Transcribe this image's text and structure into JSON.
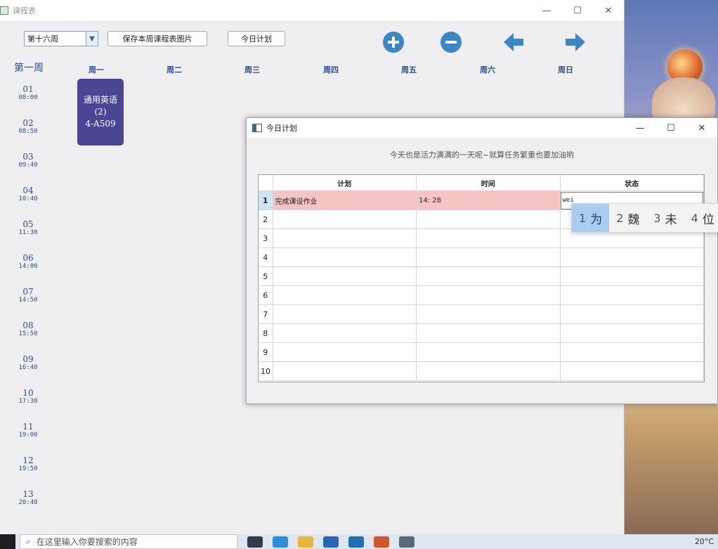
{
  "main_window": {
    "title": "课程表",
    "controls": {
      "minimize": "—",
      "maximize": "☐",
      "close": "✕"
    }
  },
  "toolbar": {
    "week_selected": "第十六周",
    "save_button": "保存本周课程表图片",
    "plan_button": "今日计划",
    "accent_color": "#3d86c5"
  },
  "schedule": {
    "week_label": "第一周",
    "days": [
      "周一",
      "周二",
      "周三",
      "周四",
      "周五",
      "周六",
      "周日"
    ],
    "periods": [
      {
        "num": "01",
        "time": "08:00"
      },
      {
        "num": "02",
        "time": "08:50"
      },
      {
        "num": "03",
        "time": "09:40"
      },
      {
        "num": "04",
        "time": "10:40"
      },
      {
        "num": "05",
        "time": "11:30"
      },
      {
        "num": "06",
        "time": "14:00"
      },
      {
        "num": "07",
        "time": "14:50"
      },
      {
        "num": "08",
        "time": "15:50"
      },
      {
        "num": "09",
        "time": "16:40"
      },
      {
        "num": "10",
        "time": "17:30"
      },
      {
        "num": "11",
        "time": "19:00"
      },
      {
        "num": "12",
        "time": "19:50"
      },
      {
        "num": "13",
        "time": "20:40"
      }
    ],
    "course": {
      "name": "通用英语",
      "section": "(2)",
      "room": "4-A509",
      "color": "#4a4694"
    }
  },
  "dialog": {
    "title": "今日计划",
    "motto": "今天也是活力满满的一天呢~就算任务繁重也要加油哟",
    "columns": [
      "计划",
      "时间",
      "状态"
    ],
    "rows": [
      {
        "n": "1",
        "plan": "完成课设作业",
        "time": "14: 28",
        "status": "wei"
      },
      {
        "n": "2",
        "plan": "",
        "time": "",
        "status": ""
      },
      {
        "n": "3",
        "plan": "",
        "time": "",
        "status": ""
      },
      {
        "n": "4",
        "plan": "",
        "time": "",
        "status": ""
      },
      {
        "n": "5",
        "plan": "",
        "time": "",
        "status": ""
      },
      {
        "n": "6",
        "plan": "",
        "time": "",
        "status": ""
      },
      {
        "n": "7",
        "plan": "",
        "time": "",
        "status": ""
      },
      {
        "n": "8",
        "plan": "",
        "time": "",
        "status": ""
      },
      {
        "n": "9",
        "plan": "",
        "time": "",
        "status": ""
      },
      {
        "n": "10",
        "plan": "",
        "time": "",
        "status": ""
      }
    ]
  },
  "ime": {
    "candidates": [
      {
        "n": "1",
        "text": "为"
      },
      {
        "n": "2",
        "text": "魏"
      },
      {
        "n": "3",
        "text": "未"
      },
      {
        "n": "4",
        "text": "位"
      }
    ]
  },
  "taskbar": {
    "search_placeholder": "在这里输入你要搜索的内容",
    "tray": "20°C"
  }
}
